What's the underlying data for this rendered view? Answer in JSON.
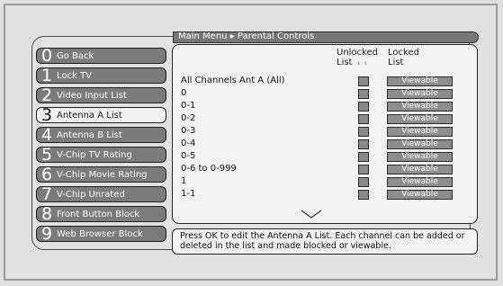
{
  "breadcrumb": {
    "root": "Main Menu",
    "separator": "▸",
    "current": "Parental Controls"
  },
  "menu": [
    {
      "num": "0",
      "label": "Go Back",
      "selected": false
    },
    {
      "num": "1",
      "label": "Lock TV",
      "selected": false
    },
    {
      "num": "2",
      "label": "Video Input List",
      "selected": false
    },
    {
      "num": "3",
      "label": "Antenna A List",
      "selected": true
    },
    {
      "num": "4",
      "label": "Antenna B List",
      "selected": false
    },
    {
      "num": "5",
      "label": "V-Chip TV Rating",
      "selected": false
    },
    {
      "num": "6",
      "label": "V-Chip Movie Rating",
      "selected": false
    },
    {
      "num": "7",
      "label": "V-Chip Unrated",
      "selected": false
    },
    {
      "num": "8",
      "label": "Front Button Block",
      "selected": false
    },
    {
      "num": "9",
      "label": "Web Browser Block",
      "selected": false
    }
  ],
  "columns": {
    "unlocked_line1": "Unlocked",
    "unlocked_line2": "List",
    "locked_line1": "Locked",
    "locked_line2": "List"
  },
  "channels": [
    {
      "name": "All Channels Ant A (All)",
      "status": "Viewable"
    },
    {
      "name": "0",
      "status": "Viewable"
    },
    {
      "name": "0-1",
      "status": "Viewable"
    },
    {
      "name": "0-2",
      "status": "Viewable"
    },
    {
      "name": "0-3",
      "status": "Viewable"
    },
    {
      "name": "0-4",
      "status": "Viewable"
    },
    {
      "name": "0-5",
      "status": "Viewable"
    },
    {
      "name": "0-6 to 0-999",
      "status": "Viewable"
    },
    {
      "name": "1",
      "status": "Viewable"
    },
    {
      "name": "1-1",
      "status": "Viewable"
    }
  ],
  "info": "Press OK to edit the Antenna A List. Each channel can be added or deleted in the list and made blocked or viewable.",
  "icons": {
    "scroll_down": "triangle-down-icon",
    "menu_separator": "triangle-right-icon"
  }
}
